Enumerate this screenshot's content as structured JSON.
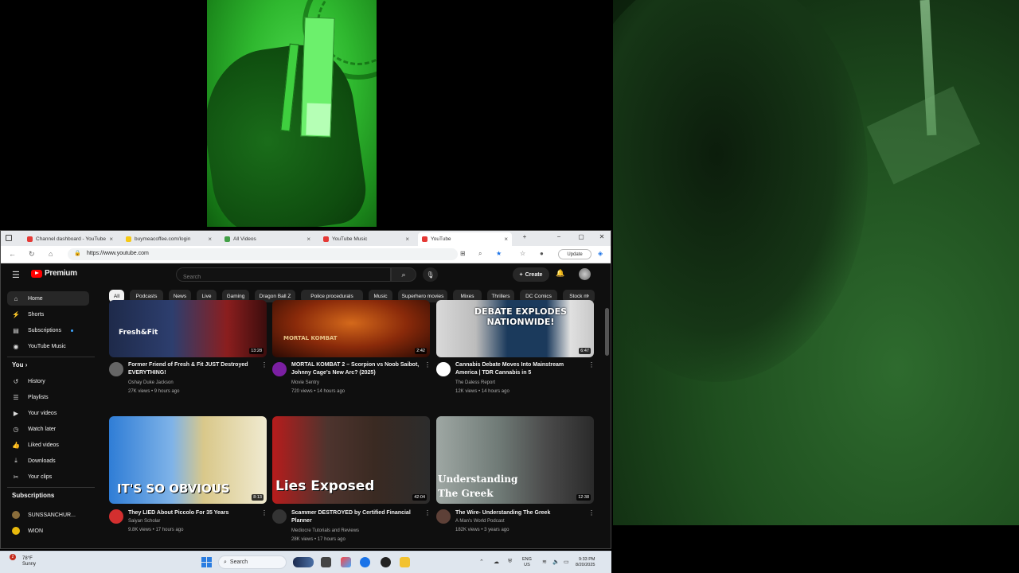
{
  "browser": {
    "tabs": [
      {
        "title": "Channel dashboard - YouTube",
        "favicon_color": "#e53935"
      },
      {
        "title": "buymeacoffee.com/login",
        "favicon_color": "#f6c915"
      },
      {
        "title": "All Videos",
        "favicon_color": "#43a047"
      },
      {
        "title": "YouTube Music",
        "favicon_color": "#e53935"
      },
      {
        "title": "YouTube",
        "favicon_color": "#e53935"
      }
    ],
    "new_tab": "+",
    "url": "https://www.youtube.com",
    "update_label": "Update",
    "window_controls": {
      "minimize": "−",
      "maximize": "▢",
      "close": "✕"
    }
  },
  "youtube": {
    "logo_text": "Premium",
    "search_placeholder": "Search",
    "create_label": "Create",
    "sidebar": {
      "main": [
        {
          "label": "Home",
          "icon": "home-icon",
          "glyph": "⌂"
        },
        {
          "label": "Shorts",
          "icon": "shorts-icon",
          "glyph": "⚡"
        },
        {
          "label": "Subscriptions",
          "icon": "subscriptions-icon",
          "glyph": "▤"
        },
        {
          "label": "YouTube Music",
          "icon": "music-icon",
          "glyph": "◉"
        }
      ],
      "you_heading": "You",
      "you": [
        {
          "label": "History",
          "icon": "history-icon",
          "glyph": "↺"
        },
        {
          "label": "Playlists",
          "icon": "playlists-icon",
          "glyph": "☰"
        },
        {
          "label": "Your videos",
          "icon": "your-videos-icon",
          "glyph": "▶"
        },
        {
          "label": "Watch later",
          "icon": "watch-later-icon",
          "glyph": "◷"
        },
        {
          "label": "Liked videos",
          "icon": "liked-icon",
          "glyph": "👍"
        },
        {
          "label": "Downloads",
          "icon": "downloads-icon",
          "glyph": "⤓"
        },
        {
          "label": "Your clips",
          "icon": "clips-icon",
          "glyph": "✂"
        }
      ],
      "subs_heading": "Subscriptions",
      "subscriptions": [
        {
          "label": "SUNSSANCHUR...",
          "color": "#8a6d3b"
        },
        {
          "label": "WION",
          "color": "#e8b90c"
        }
      ]
    },
    "chips": [
      "All",
      "Podcasts",
      "News",
      "Live",
      "Gaming",
      "Dragon Ball Z",
      "Police procedurals",
      "Music",
      "Superhero movies",
      "Mixes",
      "Thrillers",
      "DC Comics",
      "Stock m"
    ],
    "videos": [
      {
        "title": "Former Friend of Fresh & Fit JUST Destroyed EVERYTHING!",
        "channel": "Oshay Duke Jackson",
        "stats": "27K views • 9 hours ago",
        "duration": "13:28",
        "thumb_text": "Fresh&Fit",
        "ava": "#666"
      },
      {
        "title": "MORTAL KOMBAT 2 – Scorpion vs Noob Saibot, Johnny Cage's New Arc? (2025)",
        "channel": "Movie Sentry",
        "stats": "720 views • 14 hours ago",
        "duration": "2:42",
        "thumb_text": "MORTAL KOMBAT",
        "ava": "#7b1fa2"
      },
      {
        "title": "Cannabis Debate Moves Into Mainstream America | TDR Cannabis in 5",
        "channel": "The Daless Report",
        "stats": "12K views • 14 hours ago",
        "duration": "6:47",
        "thumb_text": "DEBATE EXPLODES NATIONWIDE!",
        "ava": "#ffffff"
      },
      {
        "title": "They LIED About Piccolo For 35 Years",
        "channel": "Saiyan Scholar",
        "stats": "9.8K views • 17 hours ago",
        "duration": "8:13",
        "thumb_text": "IT'S SO OBVIOUS",
        "ava": "#d32f2f"
      },
      {
        "title": "Scammer DESTROYED by Certified Financial Planner",
        "channel": "Mediocre Tutorials and Reviews",
        "stats": "28K views • 17 hours ago",
        "duration": "42:04",
        "thumb_text": "Lies Exposed",
        "ava": "#333"
      },
      {
        "title": "The Wire- Understanding The Greek",
        "channel": "A Man's World Podcast",
        "stats": "182K views • 3 years ago",
        "duration": "12:38",
        "thumb_text": "Understanding The Greek",
        "ava": "#5d4037"
      }
    ]
  },
  "taskbar": {
    "weather_temp": "78°F",
    "weather_desc": "Sunny",
    "notif_count": "2",
    "search_label": "Search",
    "lang_top": "ENG",
    "lang_bottom": "US",
    "time": "9:33 PM",
    "date": "8/20/2025"
  },
  "colors": {
    "yt_bg": "#0f0f0f",
    "yt_red": "#ff0000",
    "chip_bg": "#272727"
  }
}
